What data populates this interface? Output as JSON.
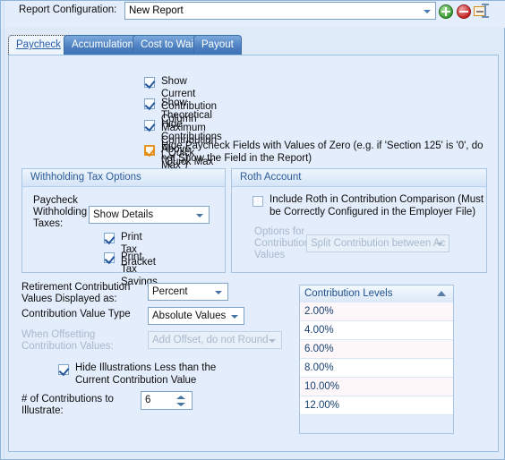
{
  "header": {
    "config_label": "Report Configuration:",
    "config_value": "New Report",
    "icons": {
      "add": "add-circle-icon",
      "delete": "delete-circle-icon",
      "rename": "rename-icon"
    }
  },
  "tabs": [
    {
      "label": "Paycheck",
      "active": true
    },
    {
      "label": "Accumulation",
      "active": false
    },
    {
      "label": "Cost to Wait",
      "active": false
    },
    {
      "label": "Payout",
      "active": false
    }
  ],
  "checkboxes": [
    {
      "label": "Show Current Contribution Column",
      "checked": true,
      "style": "normal"
    },
    {
      "label": "Show Theoretical Maximum Contribution (\"Quick Max\") Column",
      "checked": true,
      "style": "normal"
    },
    {
      "label": "Hide Contributions Above \"Quick Max\"",
      "checked": true,
      "style": "normal"
    },
    {
      "label": "Hide Paycheck Fields with Values of Zero (e.g. if 'Section 125' is '0', do not Show the Field in the Report)",
      "checked": true,
      "style": "orange"
    }
  ],
  "withholding": {
    "title": "Withholding Tax Options",
    "taxes_label": "Paycheck Withholding Taxes:",
    "taxes_value": "Show Details",
    "print_tax_bracket": {
      "label": "Print Tax Bracket",
      "checked": true
    },
    "print_tax_savings": {
      "label": "Print Tax Savings",
      "checked": true
    }
  },
  "roth": {
    "title": "Roth Account",
    "include_label": "Include Roth in Contribution Comparison (Must be Correctly Configured in the Employer File)",
    "include_checked": false,
    "options_label": "Options for Contribution Values",
    "options_value": "Split Contribution between Ac",
    "options_disabled": true
  },
  "settings": {
    "displayed_as_label": "Retirement Contribution Values Displayed as:",
    "displayed_as_value": "Percent",
    "value_type_label": "Contribution Value Type",
    "value_type_value": "Absolute Values",
    "offsetting_label": "When Offsetting Contribution Values:",
    "offsetting_value": "Add Offset, do not Round",
    "offsetting_disabled": true,
    "hide_illustrations_label": "Hide Illustrations Less than the Current Contribution Value",
    "hide_illustrations_checked": true,
    "num_contributions_label": "# of Contributions to Illustrate:",
    "num_contributions_value": "6"
  },
  "grid": {
    "column_header": "Contribution Levels",
    "sort": "ascending",
    "rows": [
      "2.00%",
      "4.00%",
      "6.00%",
      "8.00%",
      "10.00%",
      "12.00%"
    ]
  },
  "colors": {
    "panel_bg": "#e3edfb",
    "accent_blue": "#2d5c96",
    "tab_active_text": "#2a5ea8",
    "highlight_orange": "#e59325",
    "grid_row_odd": "#fdf7fa"
  }
}
